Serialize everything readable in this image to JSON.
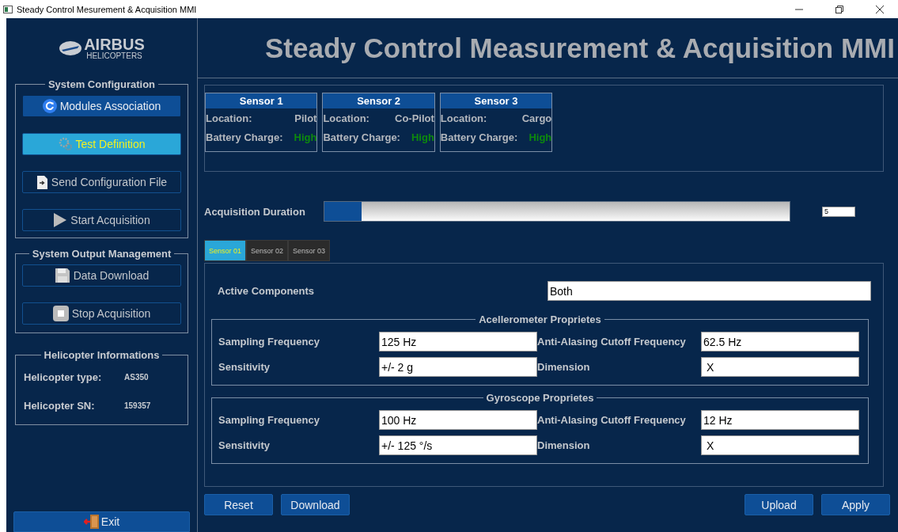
{
  "window": {
    "title": "Steady Control Mesurement & Acquisition MMI"
  },
  "logo": {
    "name": "AIRBUS",
    "sub": "HELICOPTERS"
  },
  "header": {
    "title": "Steady Control Measurement & Acquisition MMI"
  },
  "system_configuration": {
    "title": "System Configuration",
    "buttons": [
      {
        "label": "Modules Association",
        "kind": "primary",
        "selected": false
      },
      {
        "label": "Test Definition",
        "kind": "outline",
        "selected": true
      },
      {
        "label": "Send Configuration File",
        "kind": "outline",
        "selected": false
      },
      {
        "label": "Start Acquisition",
        "kind": "outline",
        "selected": false
      }
    ]
  },
  "system_output_management": {
    "title": "System Output Management",
    "buttons": [
      {
        "label": "Data Download",
        "kind": "outline",
        "selected": false
      },
      {
        "label": "Stop Acquisition",
        "kind": "outline",
        "selected": false
      }
    ]
  },
  "helicopter_informations": {
    "title": "Helicopter Informations",
    "rows": [
      {
        "label": "Helicopter type:",
        "value": "AS350"
      },
      {
        "label": "Helicopter SN:",
        "value": "159357"
      }
    ]
  },
  "exit_button": {
    "label": "Exit"
  },
  "sensors": [
    {
      "title": "Sensor 1",
      "location_label": "Location:",
      "location": "Pilot",
      "battery_label": "Battery Charge:",
      "battery": "High"
    },
    {
      "title": "Sensor 2",
      "location_label": "Location:",
      "location": "Co-Pilot",
      "battery_label": "Battery Charge:",
      "battery": "High"
    },
    {
      "title": "Sensor 3",
      "location_label": "Location:",
      "location": "Cargo",
      "battery_label": "Battery Charge:",
      "battery": "High"
    }
  ],
  "acquisition_duration": {
    "label": "Acquisition Duration",
    "level": 0.08,
    "value": "5"
  },
  "tabs": [
    {
      "label": "Sensor 01",
      "selected": true
    },
    {
      "label": "Sensor 02",
      "selected": false
    },
    {
      "label": "Sensor 03",
      "selected": false
    }
  ],
  "active_components": {
    "label": "Active Components",
    "value": "Both"
  },
  "groups": [
    {
      "title": "Acellerometer Proprietes",
      "rows": [
        {
          "label": "Sampling Frequency",
          "value": "125 Hz",
          "label_2": "Anti-Alasing Cutoff Frequency",
          "value_2": "62.5 Hz"
        },
        {
          "label": "Sensitivity",
          "value": "+/- 2 g",
          "label_2": "Dimension",
          "value_2": " X"
        }
      ]
    },
    {
      "title": "Gyroscope Proprietes",
      "rows": [
        {
          "label": "Sampling Frequency",
          "value": "100 Hz",
          "label_2": "Anti-Alasing Cutoff Frequency",
          "value_2": "12 Hz"
        },
        {
          "label": "Sensitivity",
          "value": "+/- 125 °/s",
          "label_2": "Dimension",
          "value_2": " X"
        }
      ]
    }
  ],
  "bottom_buttons": {
    "left": [
      "Reset",
      "Download"
    ],
    "right": [
      "Upload",
      "Apply"
    ]
  }
}
